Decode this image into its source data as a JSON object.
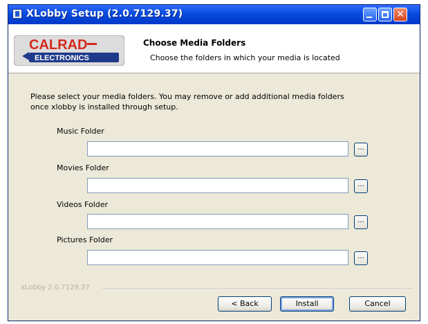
{
  "window": {
    "title": "XLobby Setup (2.0.7129.37)",
    "close_glyph": "✕"
  },
  "header": {
    "logo_top": "CALRAD",
    "logo_bottom": "ELECTRONICS",
    "title": "Choose Media Folders",
    "subtitle": "Choose the folders in which your media is located"
  },
  "main": {
    "description": "Please select your media folders. You may remove or add additional media folders once xlobby is installed through setup.",
    "browse_label": "...",
    "folders": [
      {
        "label": "Music Folder",
        "value": ""
      },
      {
        "label": "Movies Folder",
        "value": ""
      },
      {
        "label": "Videos Folder",
        "value": ""
      },
      {
        "label": "Pictures Folder",
        "value": ""
      }
    ]
  },
  "footer": {
    "branding": "xLobby 2.0.7129.37",
    "back_label": "< Back",
    "install_label": "Install",
    "cancel_label": "Cancel"
  },
  "colors": {
    "titlebar": "#0a4be0",
    "logo_red": "#d42a1e",
    "logo_blue": "#1f3a8a",
    "dialog_bg": "#ece9d8"
  }
}
